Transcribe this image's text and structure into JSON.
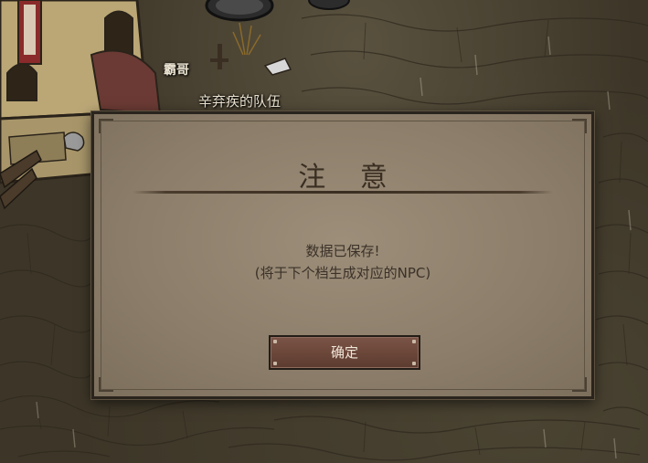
{
  "scene": {
    "npc_name": "霸哥",
    "team_label": "辛弃疾的队伍"
  },
  "dialog": {
    "title": "注 意",
    "message_line1": "数据已保存!",
    "message_line2": "(将于下个档生成对应的NPC)",
    "confirm_label": "确定"
  },
  "colors": {
    "dialog_bg": "#8b7d69",
    "title_text": "#3a2e22",
    "button_bg": "#6a4639",
    "button_text": "#f0e6d8"
  }
}
